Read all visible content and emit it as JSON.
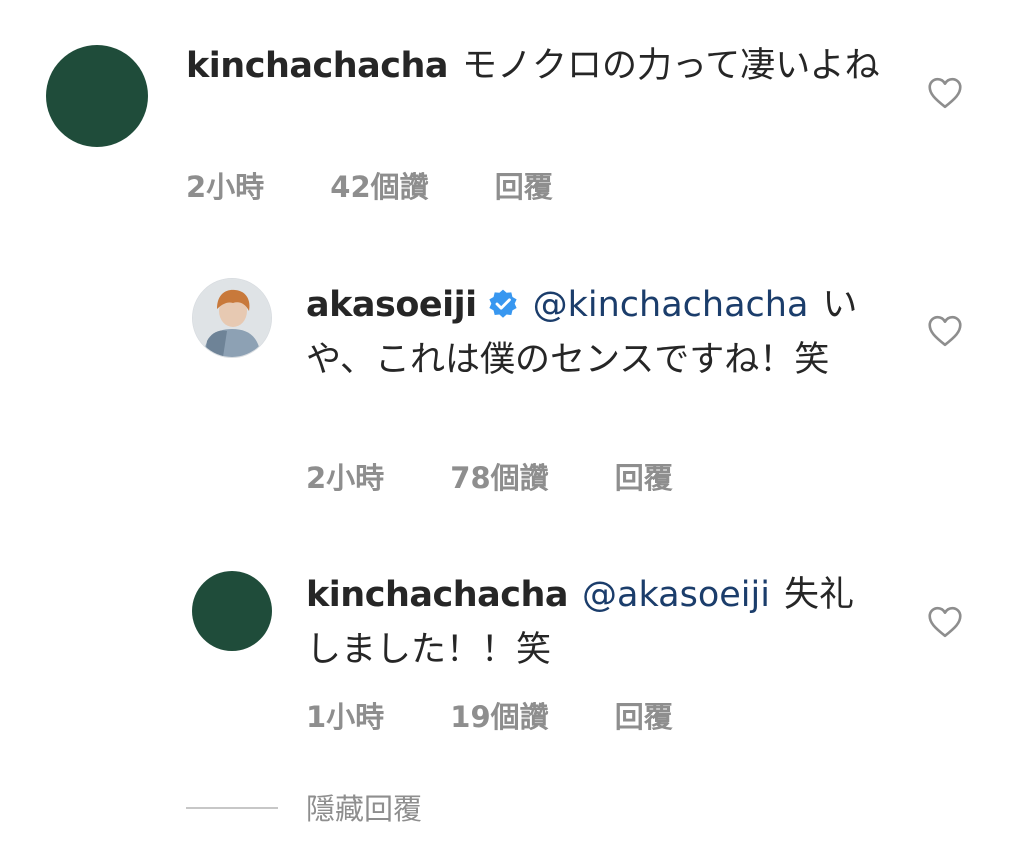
{
  "comments": [
    {
      "username": "kinchachacha",
      "mention": "",
      "text": "モノクロの力って凄いよね",
      "time": "2小時",
      "likes": "42個讚",
      "reply_label": "回覆"
    },
    {
      "username": "akasoeiji",
      "verified": true,
      "mention": "@kinchachacha",
      "text": "いや、これは僕のセンスですね！笑",
      "time": "2小時",
      "likes": "78個讚",
      "reply_label": "回覆"
    },
    {
      "username": "kinchachacha",
      "mention": "@akasoeiji",
      "text": "失礼しました！！笑",
      "time": "1小時",
      "likes": "19個讚",
      "reply_label": "回覆"
    }
  ],
  "hide_replies_label": "隱藏回覆",
  "colors": {
    "avatar_green": "#1f4c3a",
    "mention_blue": "#1b3d6b",
    "verified_blue": "#3897f0",
    "meta_gray": "#8e8e8e"
  },
  "icons": {
    "like": "heart-outline-icon",
    "verified": "verified-badge-icon"
  }
}
